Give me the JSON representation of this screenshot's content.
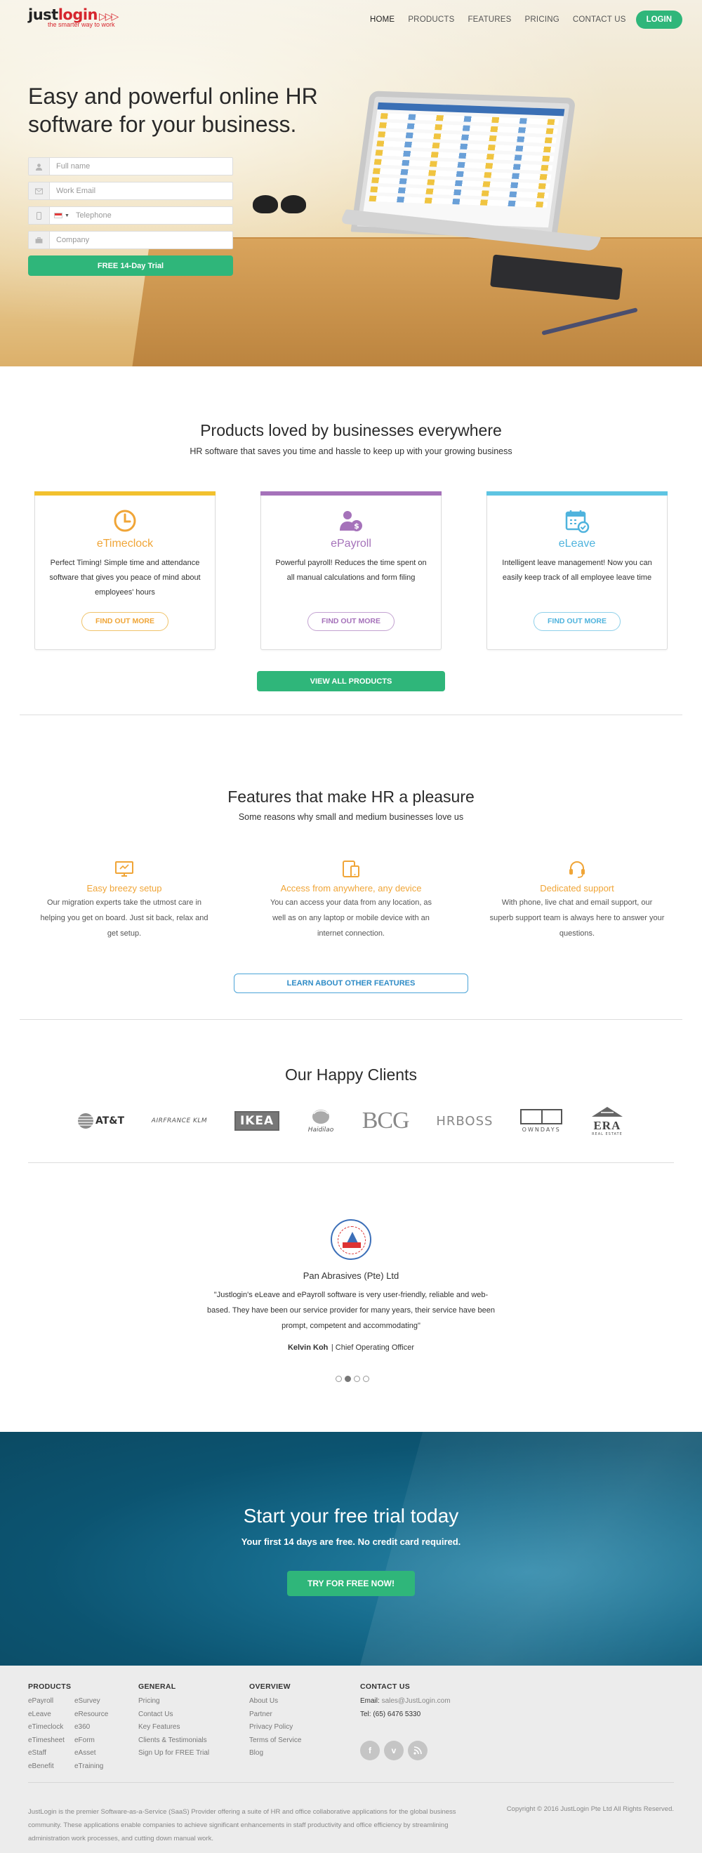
{
  "brand": {
    "logo_text": "justlogin",
    "tagline": "the smarter way to work"
  },
  "nav": {
    "items": [
      {
        "label": "HOME"
      },
      {
        "label": "PRODUCTS"
      },
      {
        "label": "FEATURES"
      },
      {
        "label": "PRICING"
      },
      {
        "label": "CONTACT US"
      }
    ],
    "login_label": "LOGIN"
  },
  "hero": {
    "title": "Easy and powerful online HR software for your business.",
    "form": {
      "fullname_placeholder": "Full name",
      "email_placeholder": "Work Email",
      "telephone_placeholder": "Telephone",
      "company_placeholder": "Company",
      "submit_label": "FREE 14-Day Trial"
    }
  },
  "products": {
    "title": "Products loved by businesses everywhere",
    "subtitle": "HR software that saves you time and hassle to keep up with your growing business",
    "cards": [
      {
        "name": "eTimeclock",
        "desc": "Perfect Timing! Simple time and attendance software that gives you peace of mind about employees' hours",
        "button": "FIND OUT MORE",
        "color": "#f0a537",
        "bar": "#f2c12e"
      },
      {
        "name": "ePayroll",
        "desc": "Powerful payroll! Reduces the time spent on all manual calculations and form filing",
        "button": "FIND OUT MORE",
        "color": "#a572ba",
        "bar": "#a572ba"
      },
      {
        "name": "eLeave",
        "desc": "Intelligent leave management! Now you can easily keep track of all employee leave time",
        "button": "FIND OUT MORE",
        "color": "#4fb3dd",
        "bar": "#5ec4e2"
      }
    ],
    "view_all_label": "VIEW ALL PRODUCTS"
  },
  "features": {
    "title": "Features that make HR a pleasure",
    "subtitle": "Some reasons why small and medium businesses love us",
    "items": [
      {
        "title": "Easy breezy setup",
        "desc": "Our migration experts take the utmost care in helping you get on board. Just sit back, relax and get setup.",
        "icon": "monitor-icon"
      },
      {
        "title": "Access from anywhere, any device",
        "desc": "You can access your data from any location, as well as on any laptop or mobile device with an internet connection.",
        "icon": "devices-icon"
      },
      {
        "title": "Dedicated support",
        "desc": "With phone, live chat and email support, our superb support team is always here to answer your questions.",
        "icon": "headset-icon"
      }
    ],
    "learn_label": "LEARN ABOUT OTHER FEATURES"
  },
  "clients": {
    "title": "Our Happy Clients",
    "logos": [
      "AT&T",
      "AIRFRANCE KLM",
      "IKEA",
      "Haidilao",
      "BCG",
      "HRBOSS",
      "OWNDAYS",
      "ERA"
    ],
    "era_sub": "REAL ESTATE"
  },
  "testimonial": {
    "company": "Pan Abrasives (Pte) Ltd",
    "quote": "\"Justlogin's eLeave and ePayroll software is very user-friendly, reliable and web-based. They have been our service provider for many years, their service have been prompt, competent and accommodating\"",
    "author": "Kelvin Koh",
    "role": "| Chief Operating Officer",
    "active_slide": 2,
    "slide_count": 4
  },
  "cta": {
    "title": "Start your free trial today",
    "subtitle": "Your first 14 days are free. No credit card required.",
    "button": "TRY FOR FREE NOW!"
  },
  "footer": {
    "products": {
      "head": "PRODUCTS",
      "col1": [
        "ePayroll",
        "eLeave",
        "eTimeclock",
        "eTimesheet",
        "eStaff",
        "eBenefit"
      ],
      "col2": [
        "eSurvey",
        "eResource",
        "e360",
        "eForm",
        "eAsset",
        "eTraining"
      ]
    },
    "general": {
      "head": "GENERAL",
      "links": [
        "Pricing",
        "Contact Us",
        "Key Features",
        "Clients & Testimonials",
        "Sign Up for FREE Trial"
      ]
    },
    "overview": {
      "head": "OVERVIEW",
      "links": [
        "About Us",
        "Partner",
        "Privacy Policy",
        "Terms of Service",
        "Blog"
      ]
    },
    "contact": {
      "head": "CONTACT US",
      "email_label": "Email:",
      "email": "sales@JustLogin.com",
      "tel": "Tel: (65) 6476 5330"
    },
    "about": "JustLogin is the premier Software-as-a-Service (SaaS) Provider offering a suite of HR and office collaborative applications for the global business community. These applications enable companies to achieve significant enhancements in staff productivity and office efficiency by streamlining administration work processes, and cutting down manual work.",
    "copyright": "Copyright © 2016 JustLogin Pte Ltd All Rights Reserved."
  }
}
